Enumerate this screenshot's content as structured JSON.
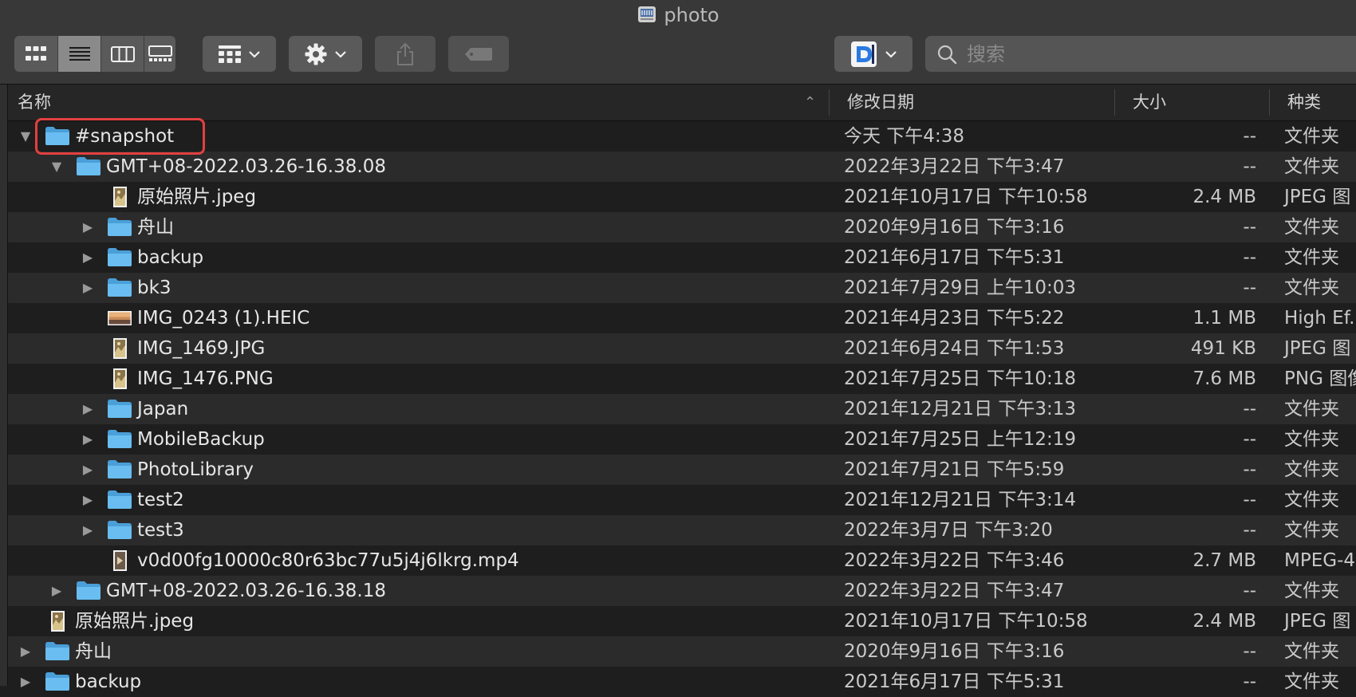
{
  "window": {
    "title": "photo"
  },
  "toolbar": {
    "view_modes": [
      "icon-view",
      "list-view",
      "column-view",
      "gallery-view"
    ],
    "selected_view": "list-view",
    "search_placeholder": "搜索"
  },
  "columns": {
    "name": "名称",
    "date": "修改日期",
    "size": "大小",
    "kind": "种类",
    "sort_indicator": "⌃"
  },
  "rows": [
    {
      "name": "#snapshot",
      "date": "今天 下午4:38",
      "size": "--",
      "kind": "文件夹",
      "level": 0,
      "type": "folder",
      "disclosure": "open",
      "highlighted": true
    },
    {
      "name": "GMT+08-2022.03.26-16.38.08",
      "date": "2022年3月22日 下午3:47",
      "size": "--",
      "kind": "文件夹",
      "level": 1,
      "type": "folder",
      "disclosure": "open"
    },
    {
      "name": "原始照片.jpeg",
      "date": "2021年10月17日 下午10:58",
      "size": "2.4 MB",
      "kind": "JPEG 图",
      "level": 2,
      "type": "image-portrait",
      "disclosure": "none"
    },
    {
      "name": "舟山",
      "date": "2020年9月16日 下午3:16",
      "size": "--",
      "kind": "文件夹",
      "level": 2,
      "type": "folder",
      "disclosure": "closed"
    },
    {
      "name": "backup",
      "date": "2021年6月17日 下午5:31",
      "size": "--",
      "kind": "文件夹",
      "level": 2,
      "type": "folder",
      "disclosure": "closed"
    },
    {
      "name": "bk3",
      "date": "2021年7月29日 上午10:03",
      "size": "--",
      "kind": "文件夹",
      "level": 2,
      "type": "folder",
      "disclosure": "closed"
    },
    {
      "name": "IMG_0243 (1).HEIC",
      "date": "2021年4月23日 下午5:22",
      "size": "1.1 MB",
      "kind": "High Ef.",
      "level": 2,
      "type": "image-landscape",
      "disclosure": "none"
    },
    {
      "name": "IMG_1469.JPG",
      "date": "2021年6月24日 下午1:53",
      "size": "491 KB",
      "kind": "JPEG 图",
      "level": 2,
      "type": "image-portrait",
      "disclosure": "none"
    },
    {
      "name": "IMG_1476.PNG",
      "date": "2021年7月25日 下午10:18",
      "size": "7.6 MB",
      "kind": "PNG 图像",
      "level": 2,
      "type": "image-portrait",
      "disclosure": "none"
    },
    {
      "name": "Japan",
      "date": "2021年12月21日 下午3:13",
      "size": "--",
      "kind": "文件夹",
      "level": 2,
      "type": "folder",
      "disclosure": "closed"
    },
    {
      "name": "MobileBackup",
      "date": "2021年7月25日 上午12:19",
      "size": "--",
      "kind": "文件夹",
      "level": 2,
      "type": "folder",
      "disclosure": "closed"
    },
    {
      "name": "PhotoLibrary",
      "date": "2021年7月21日 下午5:59",
      "size": "--",
      "kind": "文件夹",
      "level": 2,
      "type": "folder",
      "disclosure": "closed"
    },
    {
      "name": "test2",
      "date": "2021年12月21日 下午3:14",
      "size": "--",
      "kind": "文件夹",
      "level": 2,
      "type": "folder",
      "disclosure": "closed"
    },
    {
      "name": "test3",
      "date": "2022年3月7日 下午3:20",
      "size": "--",
      "kind": "文件夹",
      "level": 2,
      "type": "folder",
      "disclosure": "closed"
    },
    {
      "name": "v0d00fg10000c80r63bc77u5j4j6lkrg.mp4",
      "date": "2022年3月22日 下午3:46",
      "size": "2.7 MB",
      "kind": "MPEG-4",
      "level": 2,
      "type": "video",
      "disclosure": "none"
    },
    {
      "name": "GMT+08-2022.03.26-16.38.18",
      "date": "2022年3月22日 下午3:47",
      "size": "--",
      "kind": "文件夹",
      "level": 1,
      "type": "folder",
      "disclosure": "closed"
    },
    {
      "name": "原始照片.jpeg",
      "date": "2021年10月17日 下午10:58",
      "size": "2.4 MB",
      "kind": "JPEG 图",
      "level": 0,
      "type": "image-portrait",
      "disclosure": "none"
    },
    {
      "name": "舟山",
      "date": "2020年9月16日 下午3:16",
      "size": "--",
      "kind": "文件夹",
      "level": 0,
      "type": "folder",
      "disclosure": "closed"
    },
    {
      "name": "backup",
      "date": "2021年6月17日 下午5:31",
      "size": "--",
      "kind": "文件夹",
      "level": 0,
      "type": "folder",
      "disclosure": "closed"
    }
  ],
  "colors": {
    "accent_highlight": "#e34040",
    "folder_blue": "#5fb3e6",
    "row_even": "#2b2b2b",
    "row_odd": "#1e1e1e"
  }
}
